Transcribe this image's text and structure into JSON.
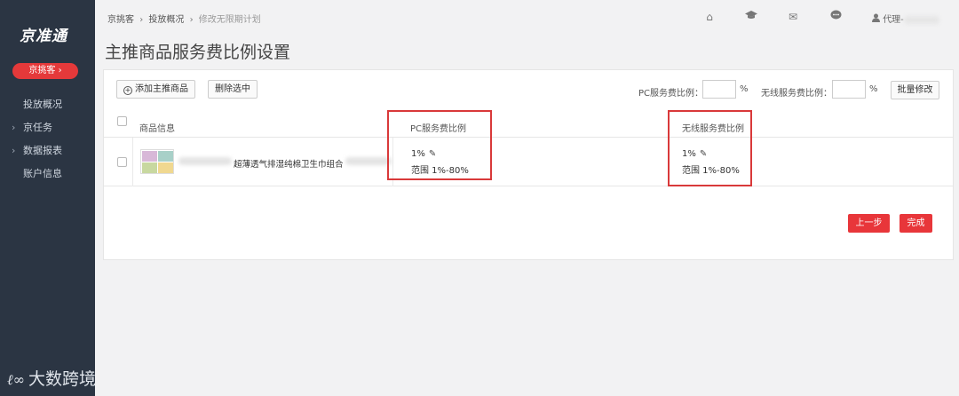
{
  "sidebar": {
    "logo": "京准通",
    "brand_button": "京挑客 ›",
    "items": [
      {
        "label": "投放概况",
        "chevron": ""
      },
      {
        "label": "京任务",
        "chevron": "›"
      },
      {
        "label": "数据报表",
        "chevron": "›"
      },
      {
        "label": "账户信息",
        "chevron": ""
      }
    ]
  },
  "watermark": {
    "logo": "ℓ∞",
    "text": "大数跨境"
  },
  "breadcrumb": {
    "item1": "京挑客",
    "item2": "投放概况",
    "current": "修改无限期计划",
    "sep": "›"
  },
  "top_icons": {
    "home": "⌂",
    "graduate": "▲",
    "mail": "✉",
    "chat": "●"
  },
  "user": {
    "icon": "👤",
    "label": "代理-"
  },
  "page_title": "主推商品服务费比例设置",
  "toolbar": {
    "add_label": "添加主推商品",
    "add_icon": "+",
    "delete_label": "删除选中",
    "pc_rate_label": "PC服务费比例：",
    "pc_rate_value": "",
    "wireless_rate_label": "无线服务费比例：",
    "wireless_rate_value": "",
    "percent": "%",
    "batch_label": "批量修改"
  },
  "table": {
    "headers": {
      "product": "商品信息",
      "pc": "PC服务费比例",
      "wireless": "无线服务费比例"
    },
    "rows": [
      {
        "product_name": "超薄透气排湿纯棉卫生巾组合",
        "pc_rate": "1%",
        "pc_range": "范围 1%-80%",
        "wireless_rate": "1%",
        "wireless_range": "范围 1%-80%",
        "edit_icon": "✎"
      }
    ]
  },
  "footer": {
    "prev_label": "上一步",
    "done_label": "完成"
  },
  "colors": {
    "sidebar": "#2b3543",
    "accent_red": "#e8363a",
    "highlight_box": "#d9393a"
  }
}
